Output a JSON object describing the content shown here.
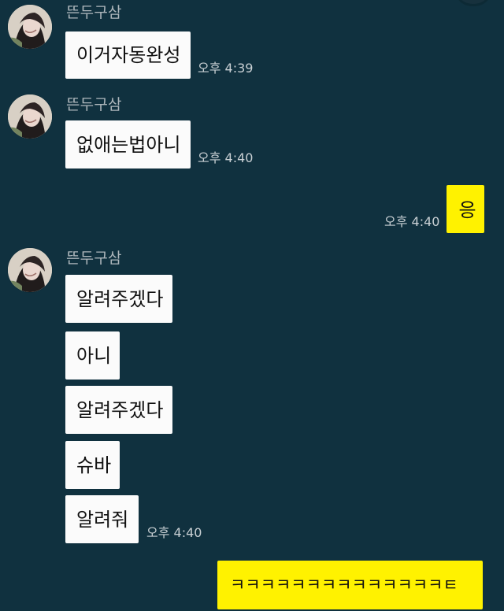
{
  "messages": [
    {
      "sender": "뜬두구삼",
      "texts": [
        "이거자동완성"
      ],
      "time": "오후 4:39"
    },
    {
      "sender": "뜬두구삼",
      "texts": [
        "없애는법아니"
      ],
      "time": "오후 4:40"
    },
    {
      "self": true,
      "texts": [
        "응"
      ],
      "time": "오후 4:40"
    },
    {
      "sender": "뜬두구삼",
      "texts": [
        "알려주겠다",
        "아니",
        "알려주겠다",
        "슈바",
        "알려줘"
      ],
      "time": "오후 4:40"
    },
    {
      "self": true,
      "texts": [
        "ㅋㅋㅋㅋㅋㅋㅋㅋㅋㅋㅋㅋㅋㅋㅌ"
      ]
    }
  ]
}
